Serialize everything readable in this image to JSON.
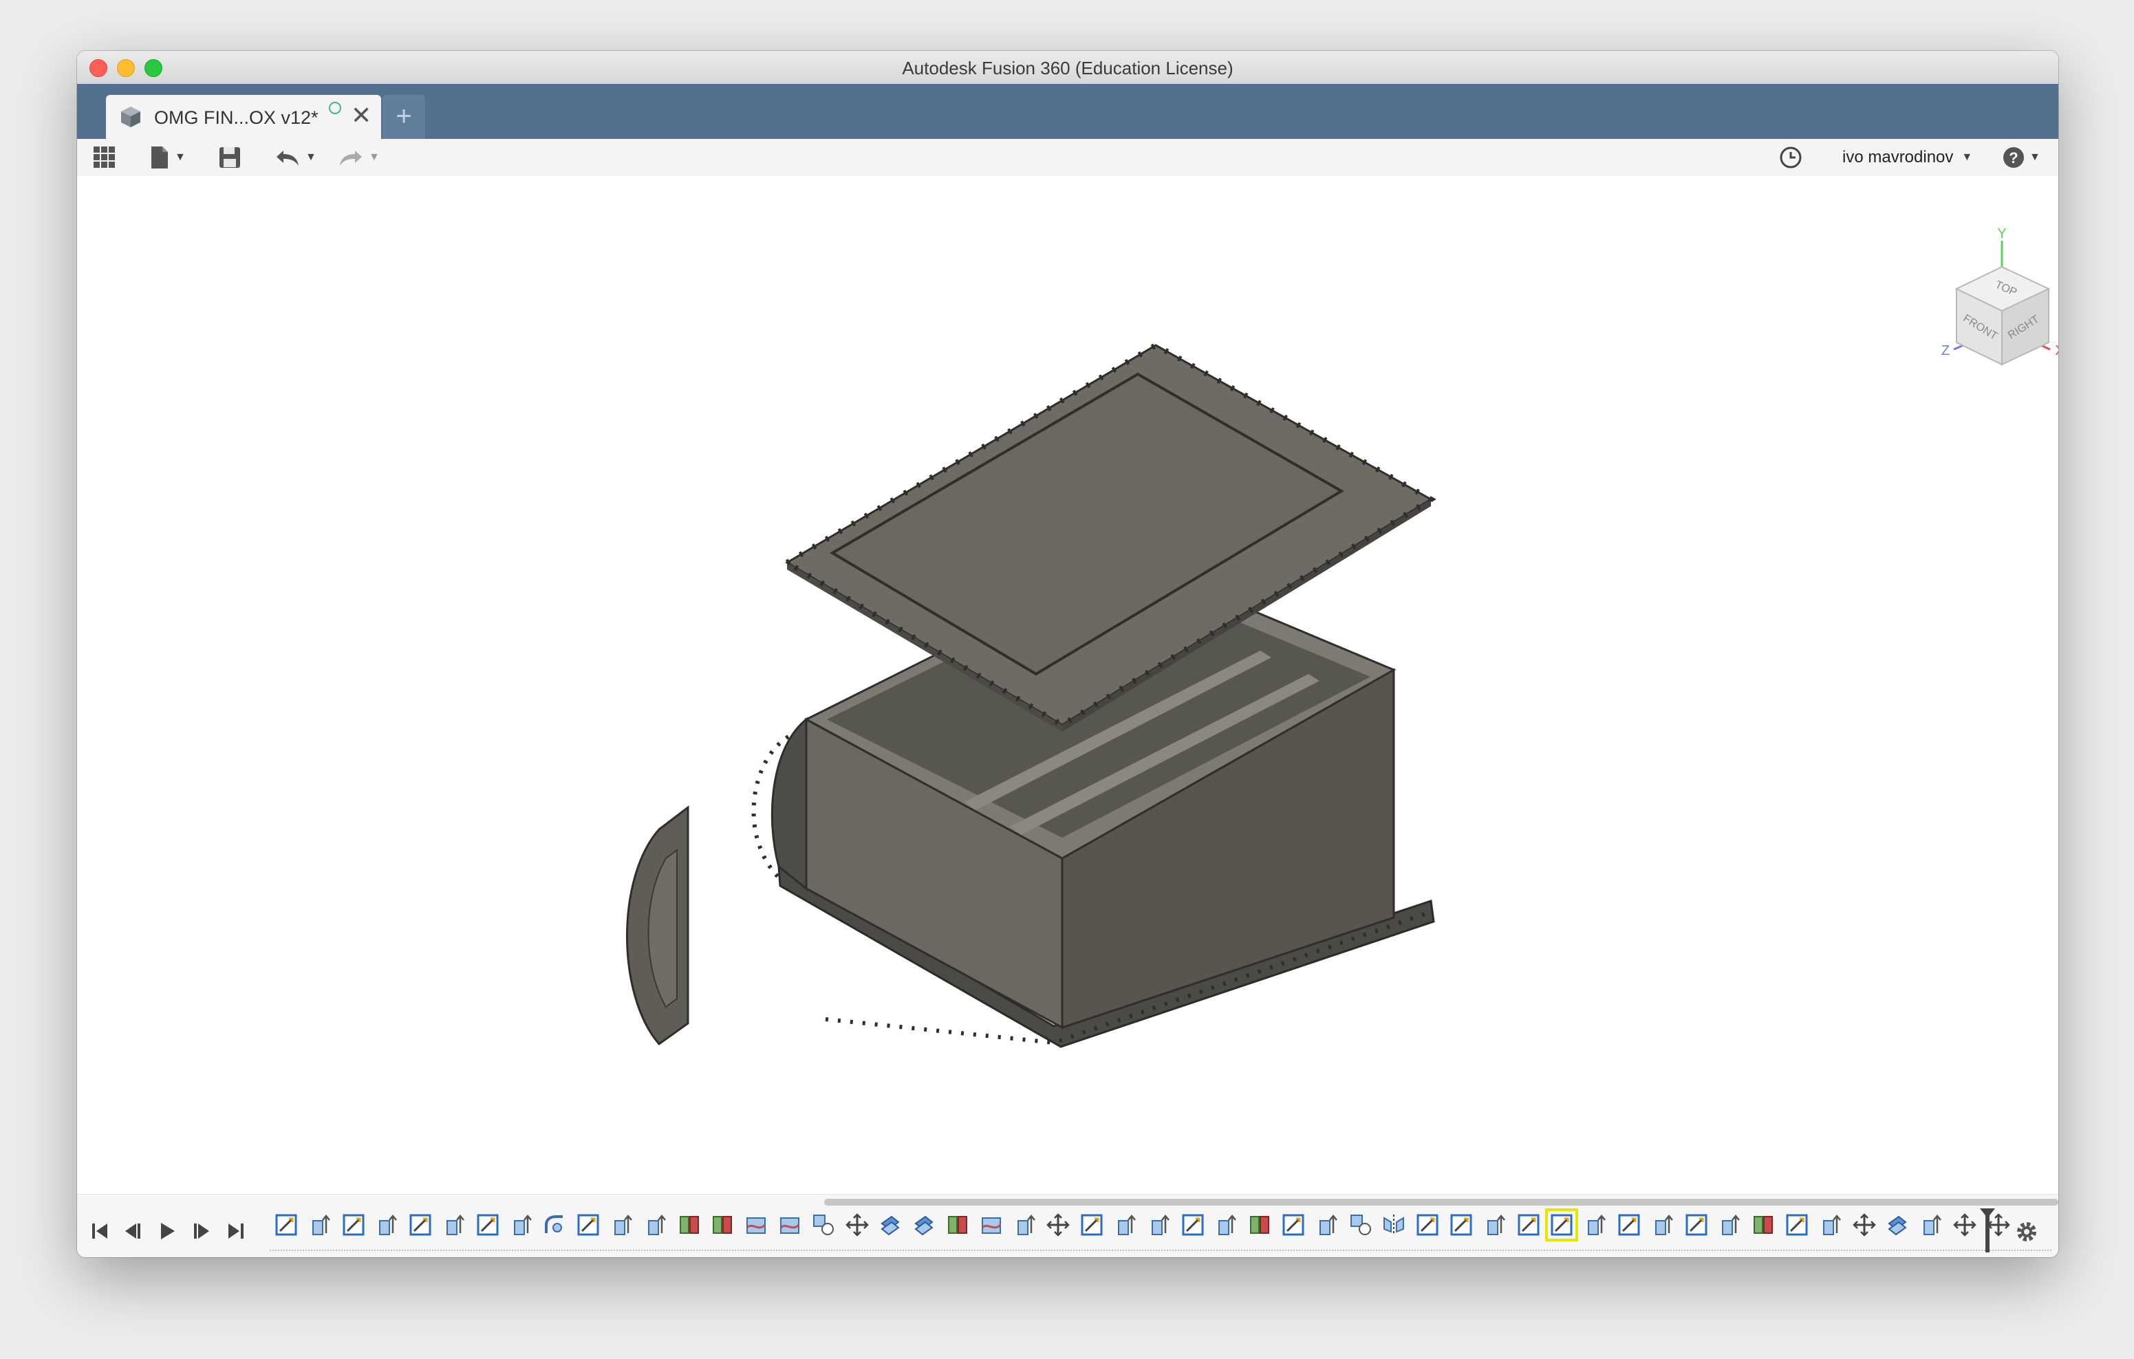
{
  "window": {
    "title": "Autodesk Fusion 360 (Education License)"
  },
  "tabs": {
    "active_label": "OMG FIN...OX v12*",
    "close_glyph": "✕",
    "new_tab_glyph": "+"
  },
  "toolbar": {
    "user_name": "ivo mavrodinov",
    "items": [
      "grid-apps-icon",
      "file-icon",
      "save-icon",
      "undo-icon",
      "redo-icon",
      "clock-icon",
      "help-icon"
    ]
  },
  "viewcube": {
    "faces": [
      "TOP",
      "FRONT",
      "RIGHT"
    ],
    "axes": {
      "x": "X",
      "y": "Y",
      "z": "Z"
    },
    "axis_colors": {
      "x": "#e44c4c",
      "y": "#5fcf5f",
      "z": "#6e7cf0"
    }
  },
  "timeline": {
    "controls": [
      "first",
      "previous",
      "play",
      "next",
      "last"
    ],
    "features": [
      "sketch",
      "extrude",
      "sketch",
      "extrude",
      "sketch",
      "extrude",
      "sketch",
      "extrude",
      "fillet",
      "sketch",
      "extrude",
      "extrude",
      "split",
      "split",
      "shell",
      "shell",
      "combine",
      "move",
      "offset",
      "offset",
      "split",
      "shell",
      "extrude",
      "move",
      "sketch",
      "extrude",
      "extrude",
      "sketch",
      "extrude",
      "split",
      "sketch",
      "extrude",
      "combine",
      "mirror",
      "sketch",
      "sketch",
      "extrude",
      "sketch",
      "sketch",
      "extrude",
      "sketch",
      "extrude",
      "sketch",
      "extrude",
      "split",
      "sketch",
      "extrude",
      "move",
      "offset",
      "extrude",
      "move",
      "move"
    ],
    "selected_index": 38,
    "accent": "#e6e600"
  },
  "colors": {
    "tabbar": "#52718e",
    "model": "#6a6860",
    "model_dark": "#4b4a44"
  }
}
